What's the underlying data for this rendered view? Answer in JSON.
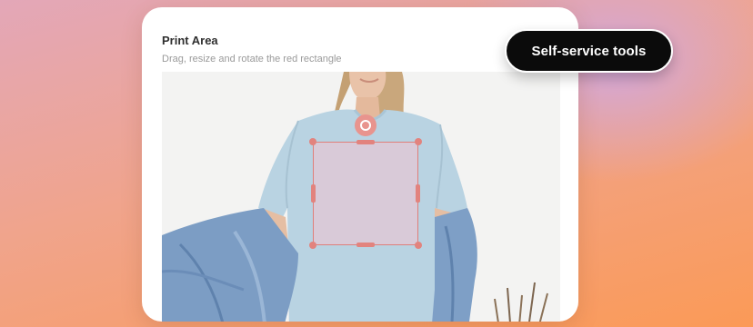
{
  "background": {
    "gradient_top": "#e3a7b8",
    "gradient_bottom": "#fb9a57",
    "glow": "#cea8e6"
  },
  "card": {
    "title": "Print Area",
    "subtitle": "Drag, resize and rotate the red rectangle"
  },
  "editor": {
    "print_area_color": "#df7f7a",
    "shirt_color": "#b9d3e2",
    "rotate_handle_icon": "rotate-icon"
  },
  "badge": {
    "label": "Self-service tools"
  }
}
